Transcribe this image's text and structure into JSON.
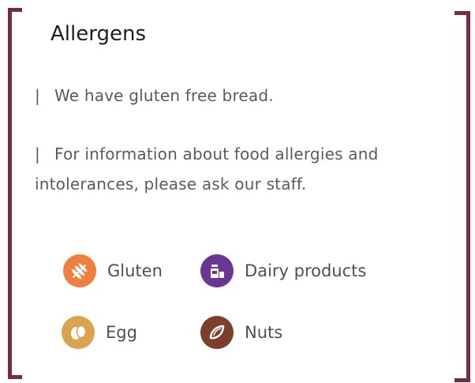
{
  "title": "Allergens",
  "info": {
    "gluten_free": "We have gluten free bread.",
    "allergy_info": "For information about food allergies and intolerances, please ask our staff."
  },
  "separator": "|",
  "allergens": [
    {
      "label": "Gluten",
      "icon": "wheat-icon",
      "color": "#f17f3b"
    },
    {
      "label": "Dairy products",
      "icon": "milk-icon",
      "color": "#6b3593"
    },
    {
      "label": "Egg",
      "icon": "egg-icon",
      "color": "#d9a44b"
    },
    {
      "label": "Nuts",
      "icon": "nut-icon",
      "color": "#7b3f2a"
    }
  ],
  "accent_color": "#7b2a3f"
}
